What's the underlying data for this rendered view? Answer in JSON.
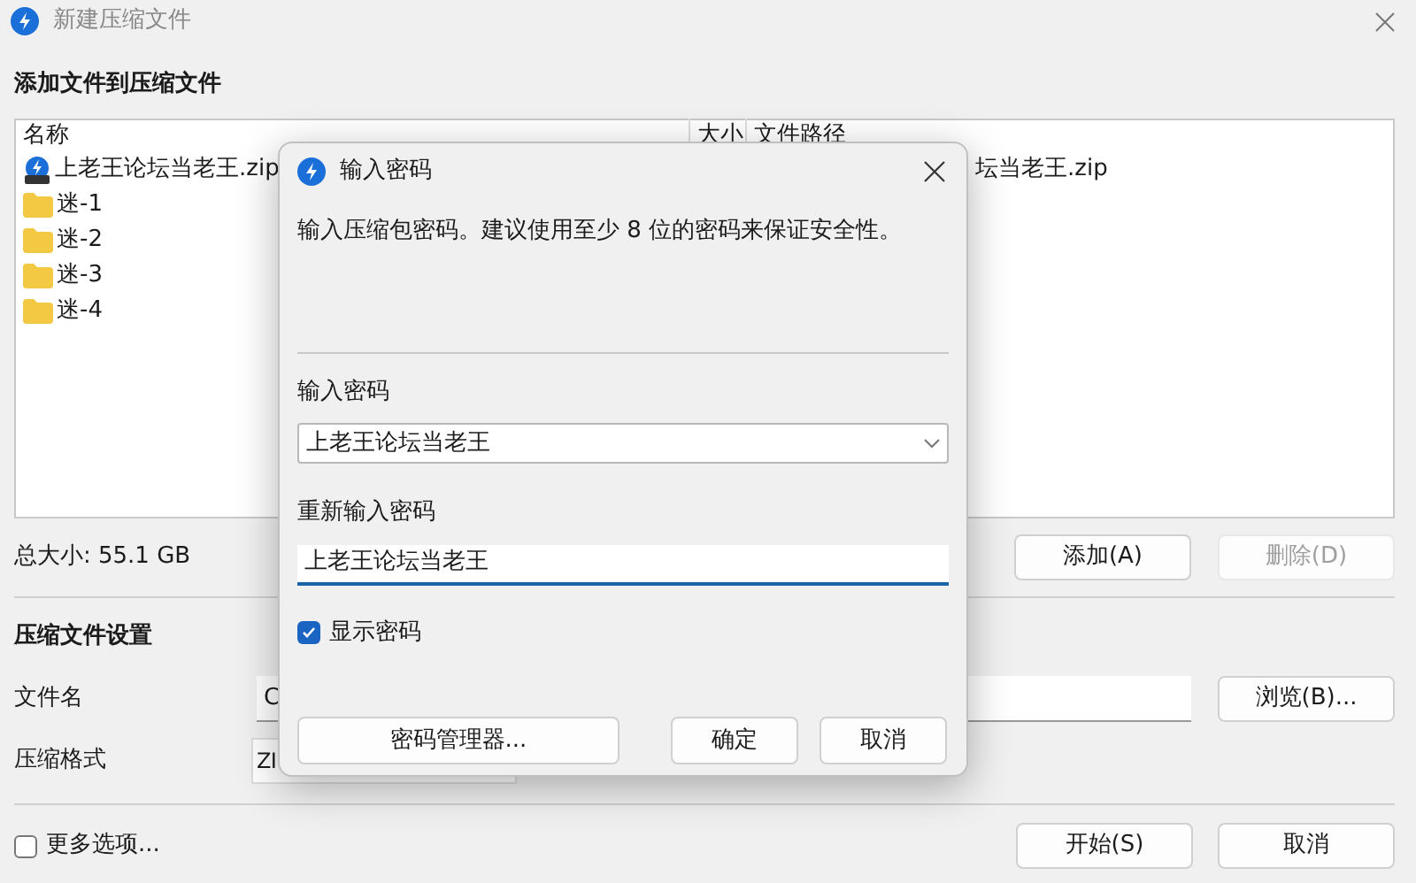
{
  "window": {
    "title": "新建压缩文件"
  },
  "files_section": {
    "heading": "添加文件到压缩文件",
    "columns": [
      "名称",
      "大小",
      "文件路径"
    ],
    "rows": [
      {
        "kind": "archive",
        "name": "上老王论坛当老王.zip",
        "path": "坛当老王.zip"
      },
      {
        "kind": "folder",
        "name": "迷-1"
      },
      {
        "kind": "folder",
        "name": "迷-2"
      },
      {
        "kind": "folder",
        "name": "迷-3"
      },
      {
        "kind": "folder",
        "name": "迷-4"
      }
    ],
    "total": "总大小: 55.1 GB",
    "buttons": [
      {
        "label": "添加(A)",
        "disabled": false
      },
      {
        "label": "删除(D)",
        "disabled": true
      }
    ]
  },
  "settings": {
    "heading": "压缩文件设置",
    "filename_label": "文件名",
    "filename_value": "C",
    "browse": "浏览(B)...",
    "format_label": "压缩格式",
    "format_value": "ZI"
  },
  "more_options": {
    "label": "更多选项...",
    "checked": false
  },
  "footer_buttons": [
    "开始(S)",
    "取消"
  ],
  "dialog": {
    "title": "输入密码",
    "description": "输入压缩包密码。建议使用至少 8 位的密码来保证安全性。",
    "password_label": "输入密码",
    "password_value": "上老王论坛当老王",
    "confirm_label": "重新输入密码",
    "confirm_value": "上老王论坛当老王",
    "show_password": {
      "label": "显示密码",
      "checked": true
    },
    "buttons": [
      {
        "kind": "manager",
        "label": "密码管理器..."
      },
      {
        "kind": "default",
        "label": "确定"
      },
      {
        "kind": "plain",
        "label": "取消"
      }
    ]
  }
}
